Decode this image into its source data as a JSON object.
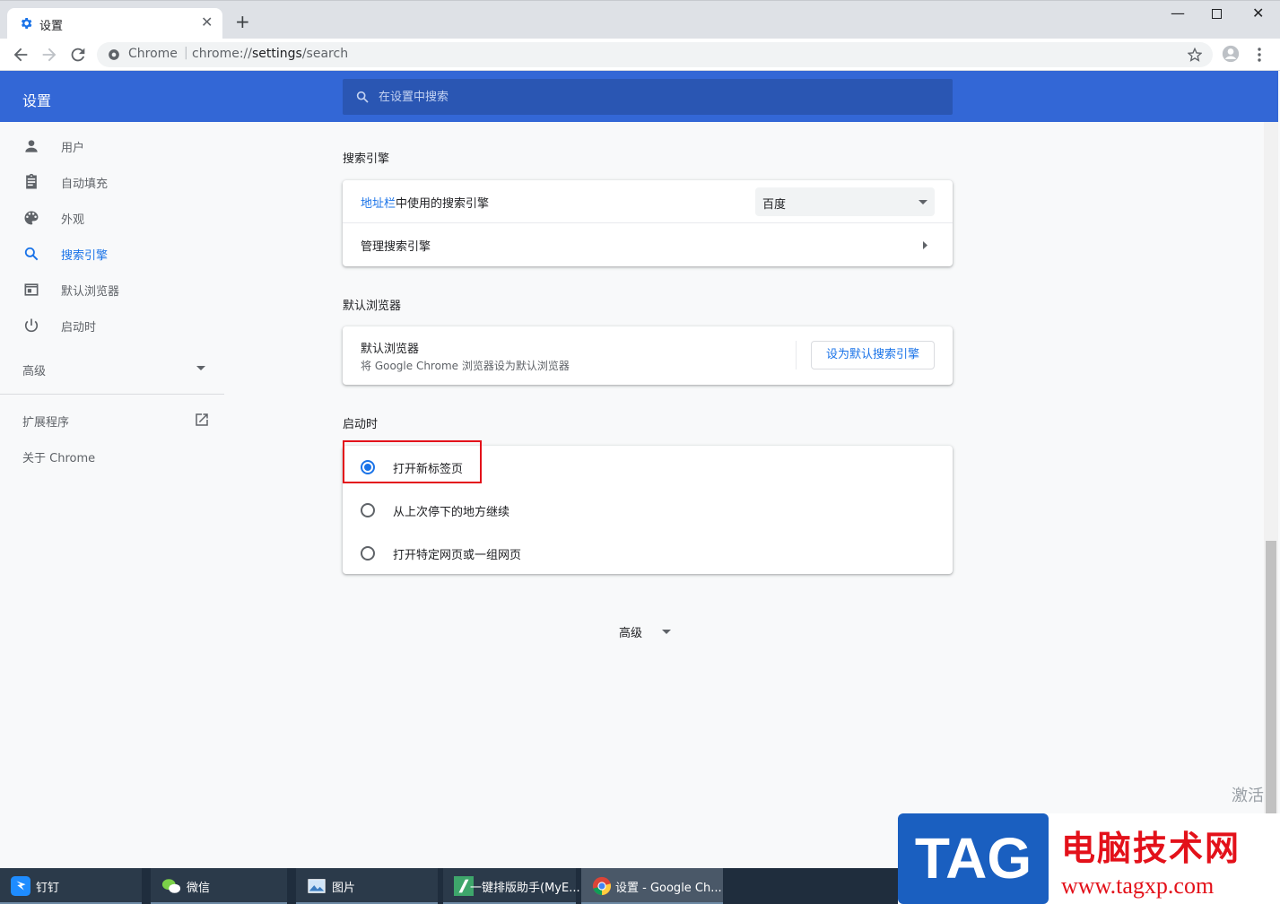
{
  "tab": {
    "title": "设置",
    "icon": "gear-icon"
  },
  "toolbar": {
    "site_label": "Chrome",
    "url_scheme": "chrome://",
    "url_host": "settings",
    "url_path": "/search"
  },
  "header": {
    "title": "设置",
    "search_placeholder": "在设置中搜索"
  },
  "sidebar": {
    "items": [
      {
        "label": "用户",
        "icon": "person-icon"
      },
      {
        "label": "自动填充",
        "icon": "clipboard-icon"
      },
      {
        "label": "外观",
        "icon": "palette-icon"
      },
      {
        "label": "搜索引擎",
        "icon": "search-icon",
        "active": true
      },
      {
        "label": "默认浏览器",
        "icon": "browser-icon"
      },
      {
        "label": "启动时",
        "icon": "power-icon"
      }
    ],
    "advanced": "高级",
    "extensions": "扩展程序",
    "about": "关于 Chrome"
  },
  "search_engine": {
    "title": "搜索引擎",
    "row1_link": "地址栏",
    "row1_text": "中使用的搜索引擎",
    "row1_value": "百度",
    "row2": "管理搜索引擎"
  },
  "default_browser": {
    "title": "默认浏览器",
    "heading": "默认浏览器",
    "sub": "将 Google Chrome 浏览器设为默认浏览器",
    "button": "设为默认搜索引擎"
  },
  "startup": {
    "title": "启动时",
    "options": [
      "打开新标签页",
      "从上次停下的地方继续",
      "打开特定网页或一组网页"
    ],
    "selected": 0
  },
  "advanced_footer": "高级",
  "taskbar": {
    "items": [
      "钉钉",
      "微信",
      "图片",
      "一键排版助手(MyE...",
      "设置 - Google Ch..."
    ]
  },
  "overlay": {
    "activate": "激活"
  },
  "watermark": {
    "tag": "TAG",
    "cn": "电脑技术网",
    "url": "www.tagxp.com"
  },
  "colors": {
    "accent": "#3367d6",
    "link": "#1a73e8",
    "highlight": "#e3111a"
  }
}
